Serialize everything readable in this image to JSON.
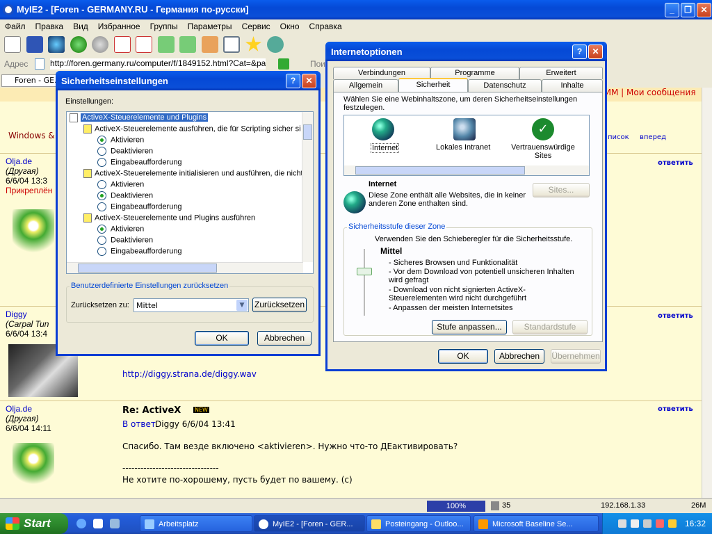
{
  "main_window": {
    "title": "MyIE2 - [Foren - GERMANY.RU - Германия по-русски]",
    "menu": [
      "Файл",
      "Правка",
      "Вид",
      "Избранное",
      "Группы",
      "Параметры",
      "Сервис",
      "Окно",
      "Справка"
    ],
    "address_label": "Адрес",
    "address_value": "http://foren.germany.ru/computer/f/1849152.html?Cat=&page",
    "search_label": "Пои",
    "tab_label": "Foren - GE..."
  },
  "forum": {
    "top_link_partial": "ИМ | Мои сообщения",
    "windows_label": "Windows &",
    "nav_list": "писок",
    "nav_forward": "вперед",
    "reply_label": "ответить",
    "posts": [
      {
        "user": "Olja.de",
        "role": "(Другая)",
        "date": "6/6/04 13:3",
        "pinned": "Прикреплён"
      },
      {
        "user": "Diggy",
        "role": "(Carpal Tun",
        "date": "6/6/04 13:4",
        "link": "http://diggy.strana.de/diggy.wav"
      },
      {
        "user": "Olja.de",
        "role": "(Другая)",
        "date": "6/6/04 14:11",
        "subject": "Re: ActiveX",
        "badge": "NEW",
        "reply_to_label": "В ответ",
        "reply_to": "Diggy 6/6/04 13:41",
        "body1": "Спасибо. Там везде включено <aktivieren>. Нужно что-то ДЕактивировать?",
        "separator": "--------------------------------",
        "body2": "Не хотите по-хорошему, пусть будет по вашему. (с)"
      }
    ]
  },
  "security_dialog": {
    "title": "Sicherheitseinstellungen",
    "settings_label": "Einstellungen:",
    "tree": [
      {
        "type": "header",
        "label": "ActiveX-Steuerelemente und Plugins"
      },
      {
        "type": "group",
        "label": "ActiveX-Steuerelemente ausführen, die für Scripting sicher si"
      },
      {
        "type": "radio",
        "label": "Aktivieren",
        "checked": true
      },
      {
        "type": "radio",
        "label": "Deaktivieren",
        "checked": false
      },
      {
        "type": "radio",
        "label": "Eingabeaufforderung",
        "checked": false
      },
      {
        "type": "group",
        "label": "ActiveX-Steuerelemente initialisieren und ausführen, die nicht"
      },
      {
        "type": "radio",
        "label": "Aktivieren",
        "checked": false
      },
      {
        "type": "radio",
        "label": "Deaktivieren",
        "checked": true
      },
      {
        "type": "radio",
        "label": "Eingabeaufforderung",
        "checked": false
      },
      {
        "type": "group",
        "label": "ActiveX-Steuerelemente und Plugins ausführen"
      },
      {
        "type": "radio",
        "label": "Aktivieren",
        "checked": true
      },
      {
        "type": "radio",
        "label": "Deaktivieren",
        "checked": false
      },
      {
        "type": "radio",
        "label": "Eingabeaufforderung",
        "checked": false
      }
    ],
    "reset_group": "Benutzerdefinierte Einstellungen zurücksetzen",
    "reset_to_label": "Zurücksetzen zu:",
    "reset_value": "Mittel",
    "reset_button": "Zurücksetzen",
    "ok": "OK",
    "cancel": "Abbrechen"
  },
  "inet_dialog": {
    "title": "Internetoptionen",
    "tabs_back": [
      "Verbindungen",
      "Programme",
      "Erweitert"
    ],
    "tabs_front": [
      "Allgemein",
      "Sicherheit",
      "Datenschutz",
      "Inhalte"
    ],
    "instruction": "Wählen Sie eine Webinhaltszone, um deren Sicherheitseinstellungen festzulegen.",
    "zones": [
      "Internet",
      "Lokales Intranet",
      "Vertrauenswürdige Sites"
    ],
    "zone_title": "Internet",
    "zone_desc": "Diese Zone enthält alle Websites, die in keiner anderen Zone enthalten sind.",
    "sites_button": "Sites...",
    "level_group": "Sicherheitsstufe dieser Zone",
    "slider_hint": "Verwenden Sie den Schieberegler für die Sicherheitsstufe.",
    "level_name": "Mittel",
    "level_items": [
      "- Sicheres Browsen und Funktionalität",
      "- Vor dem Download von potentiell unsicheren Inhalten wird gefragt",
      "- Download von nicht signierten ActiveX-Steuerelementen wird nicht durchgeführt",
      "- Anpassen der meisten Internetsites"
    ],
    "custom_button": "Stufe anpassen...",
    "default_button": "Standardstufe",
    "ok": "OK",
    "cancel": "Abbrechen",
    "apply": "Übernehmen"
  },
  "statusbar": {
    "progress": "100%",
    "count": "35",
    "ip": "192.168.1.33",
    "mem": "26M"
  },
  "taskbar": {
    "start": "Start",
    "tasks": [
      "Arbeitsplatz",
      "MyIE2 - [Foren - GER...",
      "Posteingang - Outloo...",
      "Microsoft Baseline Se..."
    ],
    "clock": "16:32"
  }
}
